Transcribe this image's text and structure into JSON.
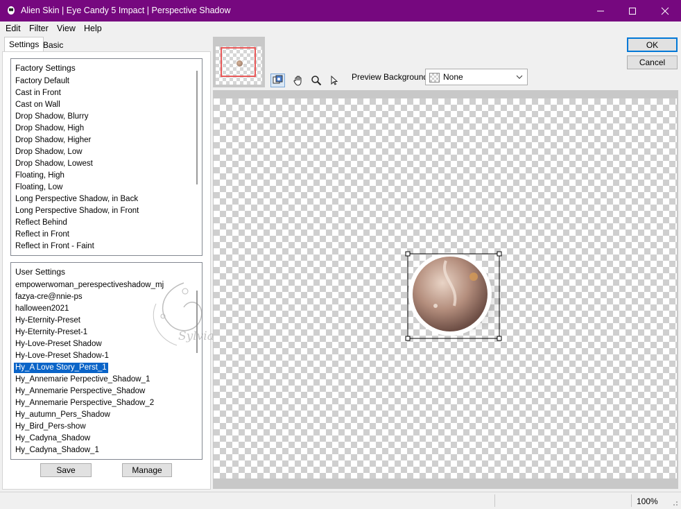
{
  "window": {
    "title": "Alien Skin | Eye Candy 5 Impact | Perspective Shadow",
    "accent_color": "#76087f"
  },
  "menu": [
    "Edit",
    "Filter",
    "View",
    "Help"
  ],
  "tabs": {
    "settings": "Settings",
    "basic": "Basic"
  },
  "factory_settings": {
    "header": "Factory Settings",
    "items": [
      "Factory Default",
      "Cast in Front",
      "Cast on Wall",
      "Drop Shadow, Blurry",
      "Drop Shadow, High",
      "Drop Shadow, Higher",
      "Drop Shadow, Low",
      "Drop Shadow, Lowest",
      "Floating, High",
      "Floating, Low",
      "Long Perspective Shadow, in Back",
      "Long Perspective Shadow, in Front",
      "Reflect Behind",
      "Reflect in Front",
      "Reflect in Front - Faint"
    ]
  },
  "user_settings": {
    "header": "User Settings",
    "items": [
      "empowerwoman_perespectiveshadow_mj",
      "fazya-cre@nnie-ps",
      "halloween2021",
      "Hy-Eternity-Preset",
      "Hy-Eternity-Preset-1",
      "Hy-Love-Preset Shadow",
      "Hy-Love-Preset Shadow-1",
      "Hy_A Love Story_Perst_1",
      "Hy_Annemarie Perpective_Shadow_1",
      "Hy_Annemarie Perspective_Shadow",
      "Hy_Annemarie Perspective_Shadow_2",
      "Hy_autumn_Pers_Shadow",
      "Hy_Bird_Pers-show",
      "Hy_Cadyna_Shadow",
      "Hy_Cadyna_Shadow_1"
    ],
    "selected": "Hy_A Love Story_Perst_1"
  },
  "buttons": {
    "save": "Save",
    "manage": "Manage",
    "ok": "OK",
    "cancel": "Cancel"
  },
  "preview_background": {
    "label": "Preview Background:",
    "value": "None"
  },
  "watermark_text": "Sylviane",
  "status": {
    "zoom": "100%"
  },
  "icons": {
    "tools": [
      "hand-icon",
      "zoom-icon",
      "pointer-icon",
      "preview-toggle-icon"
    ]
  }
}
